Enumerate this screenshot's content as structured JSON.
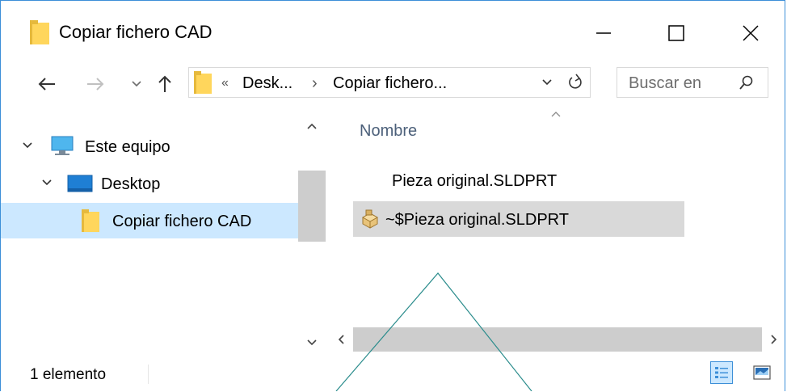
{
  "window": {
    "title": "Copiar fichero CAD",
    "controls": {
      "minimize": "minimize-icon",
      "maximize": "maximize-icon",
      "close": "close-icon"
    }
  },
  "nav": {
    "back_icon": "arrow-left-icon",
    "forward_icon": "arrow-right-icon",
    "recent_icon": "chevron-down-icon",
    "up_icon": "arrow-up-icon",
    "address": {
      "overflow": "«",
      "segments": [
        "Desk...",
        "Copiar fichero..."
      ],
      "separator": "›"
    },
    "refresh_icon": "refresh-icon",
    "search_placeholder": "Buscar en"
  },
  "tree": {
    "items": [
      {
        "label": "Este equipo",
        "icon": "computer-icon",
        "expanded": true
      },
      {
        "label": "Desktop",
        "icon": "desktop-icon",
        "expanded": true
      },
      {
        "label": "Copiar fichero CAD",
        "icon": "folder-icon",
        "selected": true
      }
    ]
  },
  "content": {
    "column_header": "Nombre",
    "files": [
      {
        "name": "Pieza original.SLDPRT",
        "icon": ""
      },
      {
        "name": "~$Pieza original.SLDPRT",
        "icon": "solidworks-part-icon"
      }
    ]
  },
  "status": {
    "count": "1 elemento",
    "views": [
      "details-view-icon",
      "large-icons-view-icon"
    ]
  },
  "colors": {
    "accent": "#3c8fd8",
    "selection": "#cce8ff",
    "hover": "#d9d9d9",
    "folder": "#ffd65c",
    "overlay_line": "#2a8c8c"
  }
}
